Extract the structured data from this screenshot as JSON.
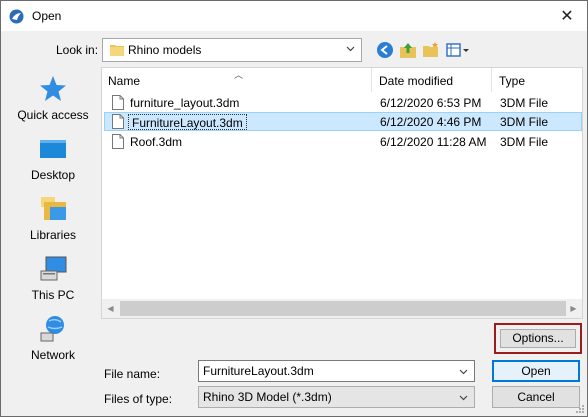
{
  "window": {
    "title": "Open",
    "close_glyph": "✕"
  },
  "lookin": {
    "label": "Look in:",
    "value": "Rhino models"
  },
  "places": [
    {
      "label": "Quick access",
      "icon": "quick-access-star-icon"
    },
    {
      "label": "Desktop",
      "icon": "desktop-icon"
    },
    {
      "label": "Libraries",
      "icon": "libraries-icon"
    },
    {
      "label": "This PC",
      "icon": "this-pc-icon"
    },
    {
      "label": "Network",
      "icon": "network-icon"
    }
  ],
  "columns": {
    "name": "Name",
    "date": "Date modified",
    "type": "Type"
  },
  "files": [
    {
      "name": "furniture_layout.3dm",
      "date": "6/12/2020 6:53 PM",
      "type": "3DM File"
    },
    {
      "name": "FurnitureLayout.3dm",
      "date": "6/12/2020 4:46 PM",
      "type": "3DM File"
    },
    {
      "name": "Roof.3dm",
      "date": "6/12/2020 11:28 AM",
      "type": "3DM File"
    }
  ],
  "options_label": "Options...",
  "filename": {
    "label": "File name:",
    "value": "FurnitureLayout.3dm"
  },
  "filetype": {
    "label": "Files of type:",
    "value": "Rhino 3D Model (*.3dm)"
  },
  "buttons": {
    "open": "Open",
    "cancel": "Cancel"
  },
  "colors": {
    "accent": "#0078d7",
    "selection": "#cce8ff",
    "highlight_frame": "#9b1c1c"
  }
}
